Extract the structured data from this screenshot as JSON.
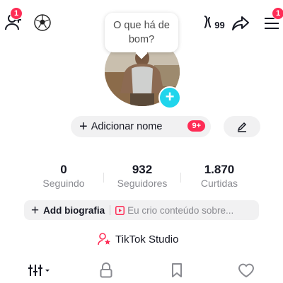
{
  "header": {
    "friends_badge": "1",
    "menu_badge": "1",
    "profile_views_label": "99"
  },
  "bubble": {
    "line1": "O que há de",
    "line2": "bom?"
  },
  "name_button": {
    "label": "Adicionar nome",
    "badge": "9+"
  },
  "stats": [
    {
      "value": "0",
      "label": "Seguindo"
    },
    {
      "value": "932",
      "label": "Seguidores"
    },
    {
      "value": "1.870",
      "label": "Curtidas"
    }
  ],
  "bio": {
    "add_label": "Add biografia",
    "placeholder": "Eu crio conteúdo sobre..."
  },
  "studio": {
    "label": "TikTok Studio"
  },
  "colors": {
    "accent": "#fe2c55",
    "avatar_add": "#20d5ec"
  }
}
